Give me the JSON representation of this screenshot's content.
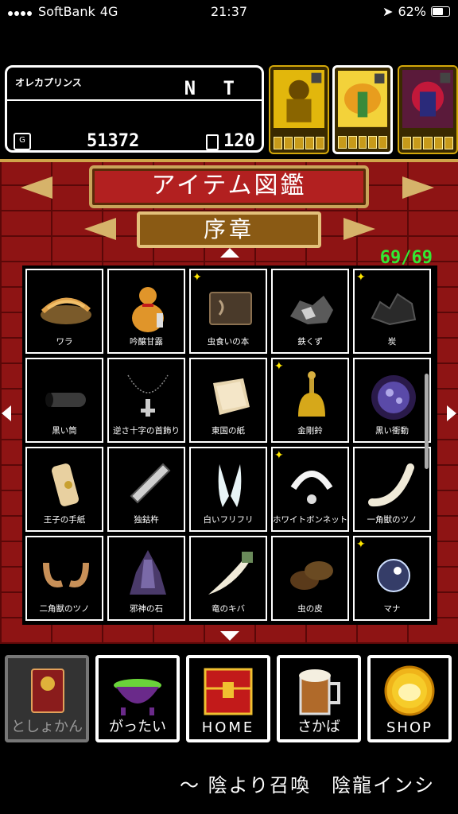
{
  "status_bar": {
    "carrier": "SoftBank",
    "network": "4G",
    "time": "21:37",
    "battery": "62%"
  },
  "player": {
    "name": "オレカプリンス",
    "tag": "N T",
    "gold_icon": "G",
    "gold": "51372",
    "cards": "120"
  },
  "header": {
    "title": "アイテム図鑑",
    "chapter": "序章",
    "count": "69/69"
  },
  "items": [
    {
      "name": "ワラ",
      "star": false,
      "icon": "straw-icon"
    },
    {
      "name": "吟醸甘露",
      "star": false,
      "icon": "gourd-icon"
    },
    {
      "name": "虫食いの本",
      "star": true,
      "icon": "book-icon"
    },
    {
      "name": "鉄くず",
      "star": false,
      "icon": "scrap-iron-icon"
    },
    {
      "name": "炭",
      "star": true,
      "icon": "charcoal-icon"
    },
    {
      "name": "黒い筒",
      "star": false,
      "icon": "black-tube-icon"
    },
    {
      "name": "逆さ十字の首飾り",
      "star": false,
      "icon": "necklace-icon"
    },
    {
      "name": "東国の紙",
      "star": false,
      "icon": "paper-icon"
    },
    {
      "name": "金剛鈴",
      "star": true,
      "icon": "bell-icon"
    },
    {
      "name": "黒い衝動",
      "star": false,
      "icon": "dark-orb-icon"
    },
    {
      "name": "王子の手紙",
      "star": false,
      "icon": "letter-icon"
    },
    {
      "name": "独鈷杵",
      "star": false,
      "icon": "vajra-icon"
    },
    {
      "name": "白いフリフリ",
      "star": false,
      "icon": "ribbon-icon"
    },
    {
      "name": "ホワイトボンネット",
      "star": true,
      "icon": "bonnet-icon"
    },
    {
      "name": "一角獣のツノ",
      "star": false,
      "icon": "horn-icon"
    },
    {
      "name": "二角獣のツノ",
      "star": false,
      "icon": "twin-horns-icon"
    },
    {
      "name": "邪神の石",
      "star": false,
      "icon": "crystal-icon"
    },
    {
      "name": "竜のキバ",
      "star": false,
      "icon": "fang-icon"
    },
    {
      "name": "虫の皮",
      "star": false,
      "icon": "bug-shell-icon"
    },
    {
      "name": "マナ",
      "star": true,
      "icon": "mana-orb-icon"
    }
  ],
  "nav": [
    {
      "label": "としょかん",
      "active": true
    },
    {
      "label": "がったい",
      "active": false
    },
    {
      "label": "HOME",
      "active": false
    },
    {
      "label": "さかば",
      "active": false
    },
    {
      "label": "SHOP",
      "active": false
    }
  ],
  "ticker": "～ 陰より召喚　陰龍インシ",
  "colors": {
    "brick": "#8e1414",
    "count_green": "#33e833",
    "gold": "#d6b36a",
    "star": "#ffe600"
  }
}
